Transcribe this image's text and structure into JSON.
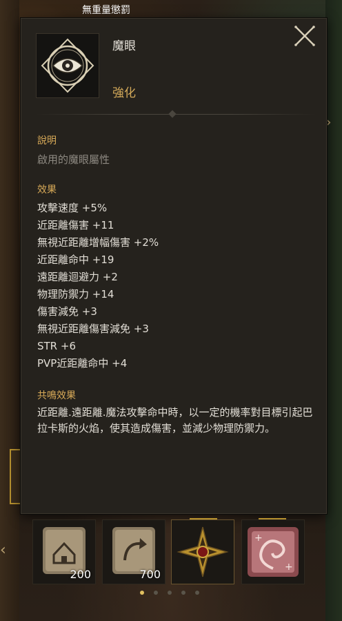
{
  "header": {
    "title": "無重量懲罰"
  },
  "item": {
    "name": "魔眼",
    "type": "強化",
    "icon": "eye-icon"
  },
  "description": {
    "label": "說明",
    "text": "啟用的魔眼屬性"
  },
  "effects": {
    "label": "效果",
    "items": [
      "攻擊速度 +5%",
      "近距離傷害 +11",
      "無視近距離增幅傷害 +2%",
      "近距離命中 +19",
      "遠距離迴避力 +2",
      "物理防禦力 +14",
      "傷害減免 +3",
      "無視近距離傷害減免 +3",
      "STR +6",
      "PVP近距離命中 +4"
    ]
  },
  "resonance": {
    "label": "共鳴效果",
    "text": "近距離.遠距離.魔法攻擊命中時，以一定的機率對目標引起巴拉卡斯的火焰，使其造成傷害，並減少物理防禦力。"
  },
  "slots": [
    {
      "icon": "house-scroll-icon",
      "count": "200"
    },
    {
      "icon": "return-scroll-icon",
      "count": "700"
    },
    {
      "icon": "compass-emblem-icon",
      "count": ""
    },
    {
      "icon": "spiral-card-icon",
      "count": ""
    }
  ],
  "pagination": {
    "pages": 5,
    "current": 1
  },
  "colors": {
    "accent_gold": "#d4aa5a",
    "panel_bg": "#25221d",
    "text_main": "#e2ded6",
    "text_dim": "#8e8a82"
  }
}
